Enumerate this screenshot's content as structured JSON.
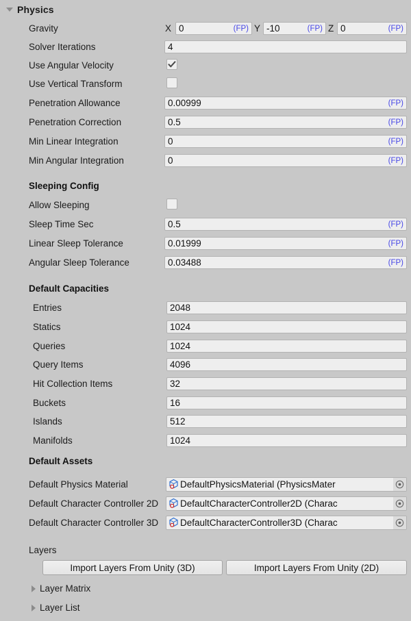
{
  "header": {
    "title": "Physics",
    "expanded": true,
    "foldout_icon": "chevron-down-icon"
  },
  "gravity": {
    "label": "Gravity",
    "axes": [
      {
        "axis": "X",
        "value": "0",
        "suffix": "(FP)"
      },
      {
        "axis": "Y",
        "value": "-10",
        "suffix": "(FP)"
      },
      {
        "axis": "Z",
        "value": "0",
        "suffix": "(FP)"
      }
    ]
  },
  "solver": {
    "label": "Solver Iterations",
    "value": "4"
  },
  "toggles": [
    {
      "label": "Use Angular Velocity",
      "checked": true,
      "icon": "checkmark-icon"
    },
    {
      "label": "Use Vertical Transform",
      "checked": false,
      "icon": "checkbox-empty-icon"
    }
  ],
  "physics_fields": [
    {
      "label": "Penetration Allowance",
      "value": "0.00999",
      "suffix": "(FP)"
    },
    {
      "label": "Penetration Correction",
      "value": "0.5",
      "suffix": "(FP)"
    },
    {
      "label": "Min Linear Integration",
      "value": "0",
      "suffix": "(FP)"
    },
    {
      "label": "Min Angular Integration",
      "value": "0",
      "suffix": "(FP)"
    }
  ],
  "sleeping": {
    "section_title": "Sleeping Config",
    "allow_sleeping": {
      "label": "Allow Sleeping",
      "checked": false,
      "icon": "checkbox-empty-icon"
    },
    "fields": [
      {
        "label": "Sleep Time Sec",
        "value": "0.5",
        "suffix": "(FP)"
      },
      {
        "label": "Linear Sleep Tolerance",
        "value": "0.01999",
        "suffix": "(FP)"
      },
      {
        "label": "Angular Sleep Tolerance",
        "value": "0.03488",
        "suffix": "(FP)"
      }
    ]
  },
  "capacities": {
    "section_title": "Default Capacities",
    "fields": [
      {
        "label": "Entries",
        "value": "2048"
      },
      {
        "label": "Statics",
        "value": "1024"
      },
      {
        "label": "Queries",
        "value": "1024"
      },
      {
        "label": "Query Items",
        "value": "4096"
      },
      {
        "label": "Hit Collection Items",
        "value": "32"
      },
      {
        "label": "Buckets",
        "value": "16"
      },
      {
        "label": "Islands",
        "value": "512"
      },
      {
        "label": "Manifolds",
        "value": "1024"
      }
    ]
  },
  "assets": {
    "section_title": "Default Assets",
    "fields": [
      {
        "label": "Default Physics Material",
        "value": "DefaultPhysicsMaterial (PhysicsMater",
        "icon": "physics-asset-icon",
        "picker": "object-picker-icon"
      },
      {
        "label": "Default Character Controller 2D",
        "value": "DefaultCharacterController2D (Charac",
        "icon": "physics-asset-icon",
        "picker": "object-picker-icon"
      },
      {
        "label": "Default Character Controller 3D",
        "value": "DefaultCharacterController3D (Charac",
        "icon": "physics-asset-icon",
        "picker": "object-picker-icon"
      }
    ]
  },
  "layers": {
    "section_title": "Layers",
    "buttons": [
      {
        "label": "Import Layers From Unity (3D)"
      },
      {
        "label": "Import Layers From Unity (2D)"
      }
    ],
    "foldouts": [
      {
        "label": "Layer Matrix",
        "expanded": false,
        "icon": "chevron-right-icon"
      },
      {
        "label": "Layer List",
        "expanded": false,
        "icon": "chevron-right-icon"
      }
    ]
  },
  "colors": {
    "background": "#c8c8c8",
    "field_background": "#eeeeee",
    "field_border": "#b2b2b2",
    "text": "#191919",
    "fp_suffix": "#4646e6",
    "foldout_arrow": "#8c8c8c"
  }
}
